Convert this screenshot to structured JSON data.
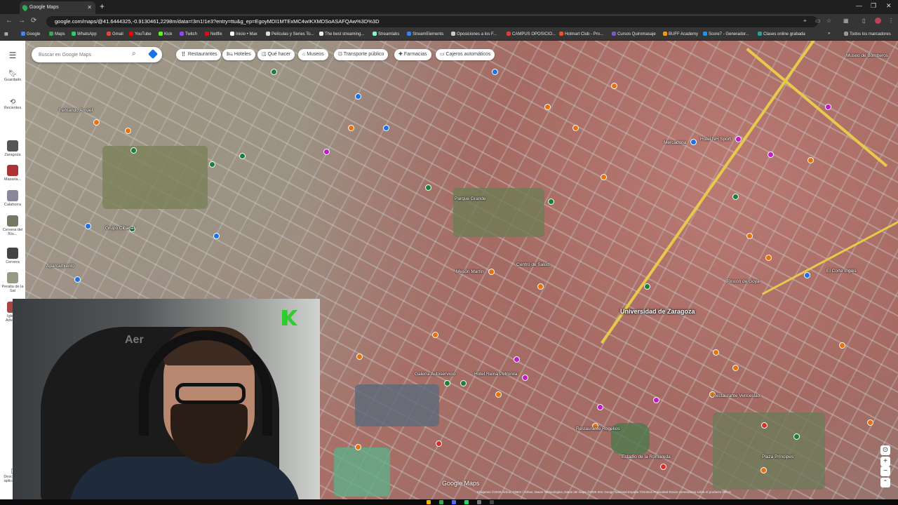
{
  "browser": {
    "tab_title": "Google Maps",
    "url": "google.com/maps/@41.6444325,-0.9130461,2298m/data=!3m1!1e3?entry=ttu&g_ep=EgoyMDI1MTExMC4wIKXMDSoASAFQAw%3D%3D"
  },
  "bookmarks": [
    "Google",
    "Maps",
    "WhatsApp",
    "Gmail",
    "YouTube",
    "Kick",
    "Twitch",
    "Netflix",
    "Inicio • Max",
    "Películas y Series To...",
    "The best streaming...",
    "Streamlabs",
    "StreamElements",
    "Oposiciones a los F...",
    "CAMPUS OPOSICIO...",
    "Hotmart Club - Pro...",
    "Cursos Quiromasaje",
    "BUFF Academy",
    "Score7 - Generador...",
    "Clases online grabada",
    "Todos los marcadores"
  ],
  "rail": {
    "saved": "Guardado",
    "recent": "Recientes",
    "items": [
      "Zaragoza",
      "Masaria...",
      "Calahorra",
      "Cervera del Río...",
      "Cervera",
      "Peralta de la Sal",
      "Iglesia Adven..."
    ],
    "bottom": "Descargar aplicación"
  },
  "search": {
    "placeholder": "Buscar en Google Maps"
  },
  "chips": [
    "Restaurantes",
    "Hoteles",
    "Qué hacer",
    "Museos",
    "Transporte público",
    "Farmacias",
    "Cajeros automáticos"
  ],
  "map": {
    "university": "Universidad de Zaragoza",
    "brand": "Google Maps",
    "attribution": "Imágenes ©2025 Airbus, CNES / Airbus, Maxar Technologies, Datos del mapa ©2025 Inst. Geogr. Nacional   España   Términos   Privacidad   Enviar comentarios sobre el producto   200 m",
    "places": [
      "Museo de Bomberos",
      "Hotel NH Sport",
      "Mercadona",
      "Grupo Cibanal",
      "Rincón de Goya",
      "Parque Grande",
      "Estadio de la Romareda",
      "Hotel Reina Petronila",
      "Restaurante Rogelios",
      "Mesón Martín",
      "Centro de Salud",
      "Plaza Príncipes",
      "Fernando Arnuel",
      "Galería Autoservicio",
      "Aparcamiento",
      "Restaurante Venceslao",
      "El Corte Inglés"
    ]
  },
  "webcam": {
    "overlay_text": "Aer"
  }
}
